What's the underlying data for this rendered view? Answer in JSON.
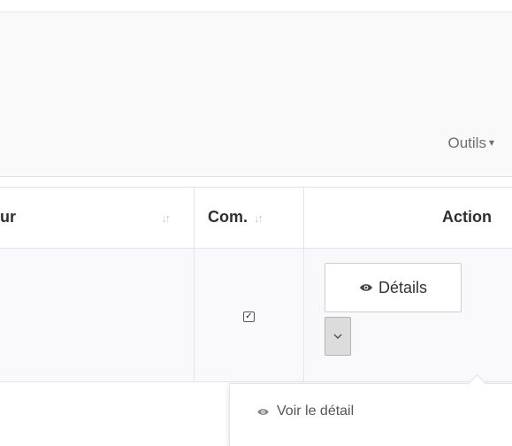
{
  "toolbar": {
    "tools_label": "Outils"
  },
  "table": {
    "columns": [
      {
        "label": "ur",
        "sortable": true
      },
      {
        "label": "Com.",
        "sortable": true
      },
      {
        "label": "Action",
        "sortable": false
      }
    ],
    "rows": [
      {
        "commented": true,
        "details_label": "Détails"
      }
    ]
  },
  "dropdown_menu": {
    "items": [
      {
        "label": "Voir le détail",
        "icon": "eye-icon"
      }
    ]
  },
  "icons": {
    "sort": "sort-icon",
    "check": "checkbox-icon",
    "eye": "eye-icon",
    "caret": "chevron-down-icon"
  },
  "colors": {
    "toolbar_bg": "#f9f9f9",
    "row_bg": "#f9f9fb",
    "toggle_bg": "#dcdcdc",
    "border": "#e4e4e4"
  }
}
